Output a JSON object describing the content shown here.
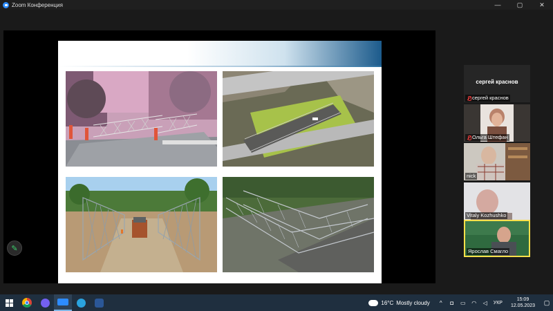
{
  "window": {
    "title": "Zoom Конференция",
    "controls": [
      "—",
      "▢",
      "✕"
    ]
  },
  "participants": [
    {
      "name": "сергей краснов",
      "display_name": "сергей краснов",
      "muted": true,
      "video": false
    },
    {
      "name": "Ольга Штефан",
      "muted": true,
      "video": true
    },
    {
      "name": "nick",
      "muted": false,
      "video": true
    },
    {
      "name": "Vitaly Kozhushko",
      "muted": false,
      "video": true
    },
    {
      "name": "Ярослав Смагло",
      "muted": false,
      "video": true,
      "active_speaker": true
    }
  ],
  "taskbar": {
    "apps": [
      "start-icon",
      "chrome-icon",
      "viber-icon",
      "zoom-icon",
      "telegram-icon",
      "word-icon"
    ],
    "weather": {
      "temp": "16°C",
      "condition": "Mostly cloudy"
    },
    "language": "УКР",
    "time": "15:09",
    "date": "12.05.2023"
  },
  "colors": {
    "active_speaker_border": "#ffe04a",
    "muted_red": "#e23b3b",
    "zoom_blue": "#2d8cff"
  }
}
